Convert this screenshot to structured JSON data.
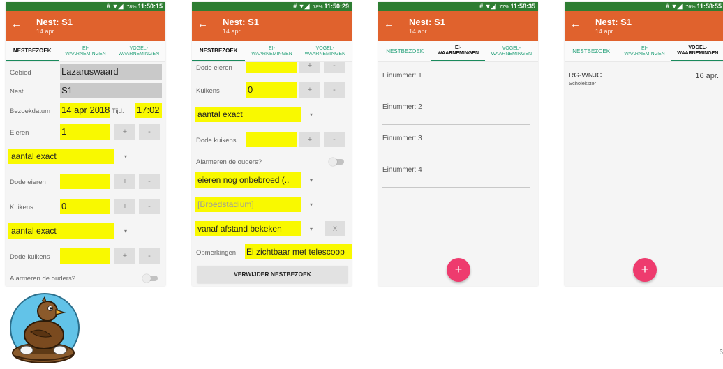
{
  "colors": {
    "statusbar": "#2e7d32",
    "appbar": "#e0622d",
    "highlight": "#f9f900",
    "tab_text": "#26a17a",
    "fab": "#ee3b6e"
  },
  "app": {
    "title": "Nest: S1",
    "subtitle": "14 apr.",
    "back_icon": "arrow-left-icon"
  },
  "tabs": {
    "nestbezoek": "NESTBEZOEK",
    "ei": "EI-\nWAARNEMINGEN",
    "vogel": "VOGEL-\nWAARNEMINGEN"
  },
  "screens": [
    {
      "status": {
        "signal": "# ▼◢",
        "battery": "78%",
        "time": "11:50:15"
      },
      "fields": {
        "gebied_label": "Gebied",
        "gebied_value": "Lazaruswaard",
        "nest_label": "Nest",
        "nest_value": "S1",
        "datum_label": "Bezoekdatum",
        "datum_value": "14 apr 2018",
        "tijd_label": "Tijd:",
        "tijd_value": "17:02",
        "eieren_label": "Eieren",
        "eieren_value": "1",
        "aantal1": "aantal exact",
        "dode_eieren_label": "Dode eieren",
        "dode_eieren_value": "",
        "kuikens_label": "Kuikens",
        "kuikens_value": "0",
        "aantal2": "aantal exact",
        "dode_kuikens_label": "Dode kuikens",
        "dode_kuikens_value": "",
        "alarm_label": "Alarmeren de ouders?"
      }
    },
    {
      "status": {
        "signal": "# ▼◢",
        "battery": "78%",
        "time": "11:50:29"
      },
      "fields": {
        "dode_eieren_label": "Dode eieren",
        "dode_eieren_value": "",
        "kuikens_label": "Kuikens",
        "kuikens_value": "0",
        "aantal": "aantal exact",
        "dode_kuikens_label": "Dode kuikens",
        "dode_kuikens_value": "",
        "alarm_label": "Alarmeren de ouders?",
        "stadium_select": "eieren nog onbebroed (..",
        "broedstadium_placeholder": "[Broedstadium]",
        "bekeken_select": "vanaf afstand bekeken",
        "clear_label": "X",
        "opmerkingen_label": "Opmerkingen",
        "opmerkingen_value": "Ei zichtbaar met telescoop",
        "delete_button": "VERWIJDER NESTBEZOEK"
      }
    },
    {
      "status": {
        "signal": "# ▼◢",
        "battery": "77%",
        "time": "11:58:35"
      },
      "eggs": [
        "Einummer: 1",
        "Einummer: 2",
        "Einummer: 3",
        "Einummer: 4"
      ],
      "fab": "+"
    },
    {
      "status": {
        "signal": "# ▼◢",
        "battery": "76%",
        "time": "11:58:55"
      },
      "bird": {
        "code": "RG-WNJC",
        "species": "Scholekster",
        "date": "16 apr."
      },
      "fab": "+"
    }
  ],
  "controls": {
    "plus": "+",
    "minus": "-",
    "caret": "▾"
  },
  "page_number": "6"
}
